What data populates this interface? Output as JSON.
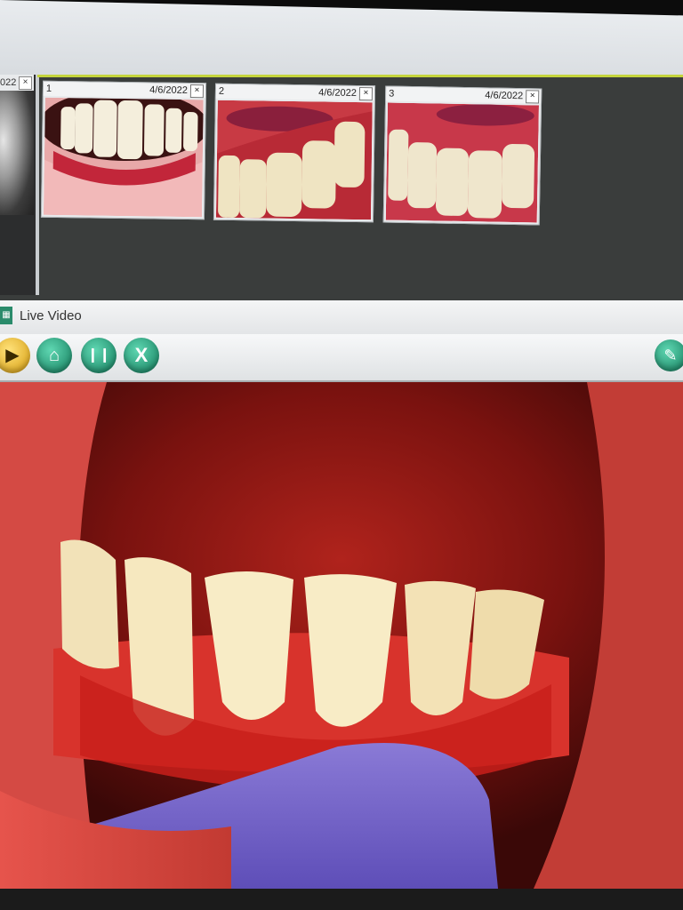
{
  "strip": {
    "left_tab_label": "022",
    "thumbnails": [
      {
        "number": "1",
        "date": "4/6/2022"
      },
      {
        "number": "2",
        "date": "4/6/2022"
      },
      {
        "number": "3",
        "date": "4/6/2022"
      }
    ],
    "close_glyph": "×"
  },
  "live_video": {
    "title": "Live Video"
  },
  "toolbar": {
    "buttons": [
      {
        "icon": "play-icon",
        "glyph": "▶"
      },
      {
        "icon": "folder-open-icon",
        "glyph": "⌂"
      },
      {
        "icon": "teeth-icon",
        "glyph": "❙❙"
      },
      {
        "icon": "close-icon",
        "glyph": "X"
      },
      {
        "icon": "wrench-icon",
        "glyph": "✎"
      }
    ]
  },
  "colors": {
    "accent_green": "#117a5a",
    "play_yellow": "#d59b0c",
    "selection_frame": "#c4d43c"
  }
}
